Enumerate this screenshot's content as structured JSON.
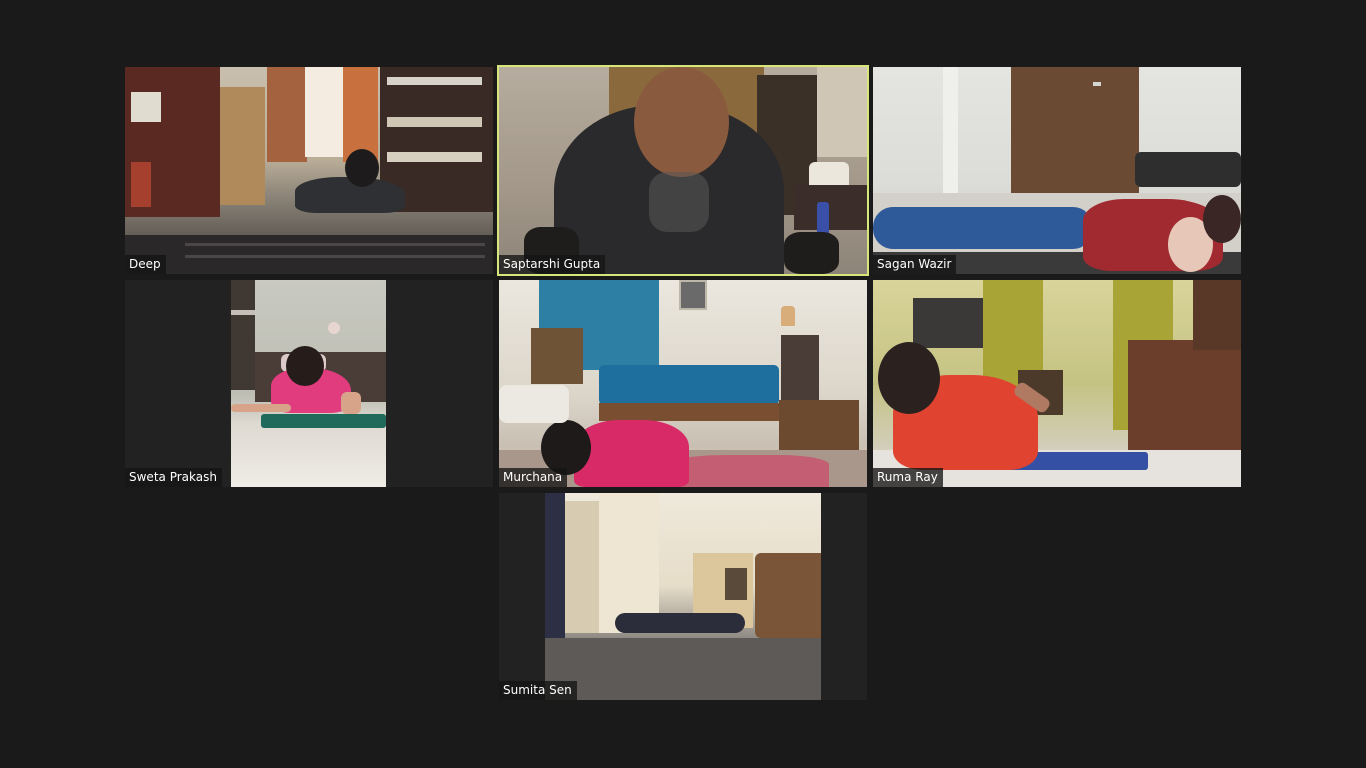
{
  "meeting": {
    "view": "Gallery View"
  },
  "participants": [
    {
      "name": "Deep",
      "active_speaker": false
    },
    {
      "name": "Saptarshi Gupta",
      "active_speaker": true
    },
    {
      "name": "Sagan Wazir",
      "active_speaker": false
    },
    {
      "name": "Sweta Prakash",
      "active_speaker": false
    },
    {
      "name": "Murchana",
      "active_speaker": false
    },
    {
      "name": "Ruma Ray",
      "active_speaker": false
    },
    {
      "name": "Sumita Sen",
      "active_speaker": false
    }
  ],
  "colors": {
    "background": "#1a1a1a",
    "tile_background": "#222222",
    "active_speaker_border": "#d6e67a",
    "name_tag_background": "rgba(20,20,20,0.78)",
    "name_tag_text": "#ffffff"
  }
}
